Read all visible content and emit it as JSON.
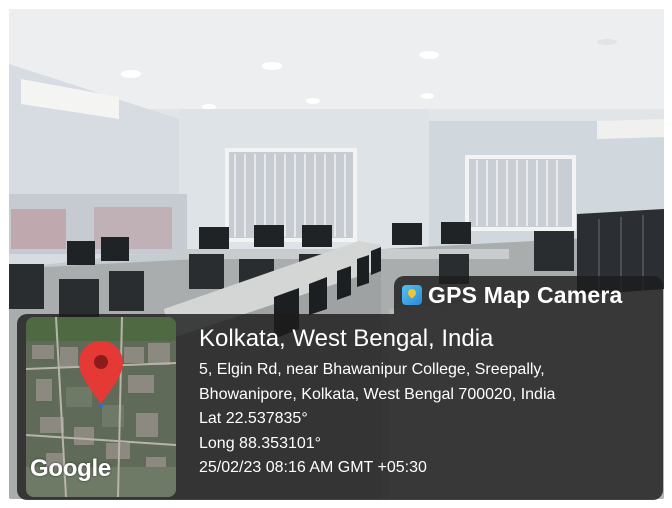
{
  "app": {
    "name": "GPS Map Camera",
    "icon": "gps-map-camera-icon"
  },
  "map": {
    "attribution": "Google",
    "pin_color": "#e53935"
  },
  "location": {
    "city": "Kolkata, West Bengal, India",
    "address_line1": "5, Elgin Rd, near Bhawanipur College, Sreepally,",
    "address_line2": "Bhowanipore, Kolkata, West Bengal 700020, India",
    "lat": "Lat 22.537835°",
    "long": "Long 88.353101°",
    "datetime": "25/02/23 08:16 AM GMT +05:30"
  }
}
